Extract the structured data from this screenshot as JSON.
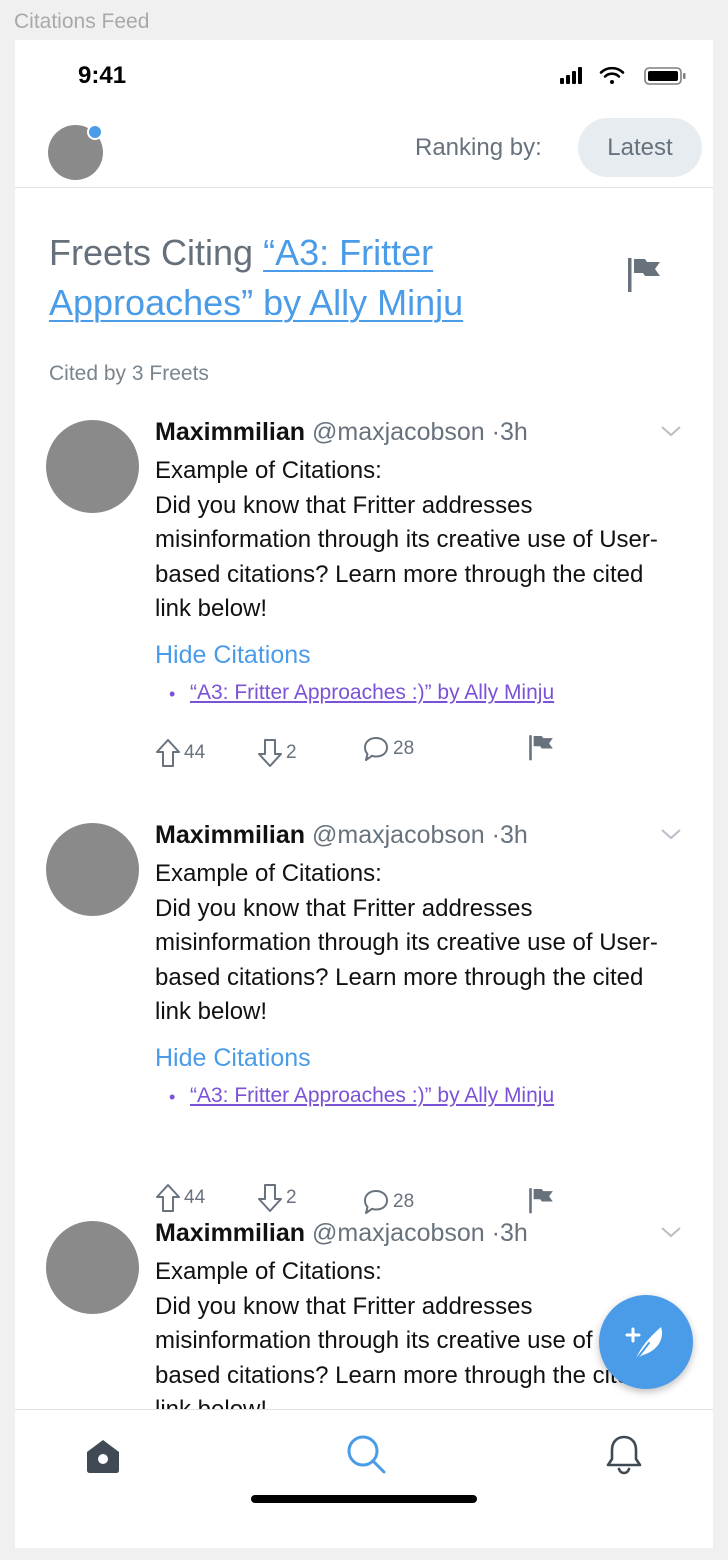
{
  "window": {
    "title": "Citations Feed"
  },
  "status_bar": {
    "time": "9:41",
    "icons": [
      "cellular-signal-icon",
      "wifi-icon",
      "battery-icon"
    ]
  },
  "header": {
    "ranking_label": "Ranking by:",
    "ranking_value": "Latest"
  },
  "page": {
    "title_prefix": "Freets Citing ",
    "title_link": "“A3: Fritter Approaches” by Ally Minju",
    "cited_count": "Cited by 3 Freets"
  },
  "freets": [
    {
      "author": "Maximmilian",
      "handle": "@maxjacobson",
      "time": "·3h",
      "body_line1": "Example of Citations:",
      "body_line2": "Did you know that Fritter addresses misinformation through its creative use of User-based citations? Learn more through the cited link below!",
      "hide_citations": "Hide Citations",
      "citation": "“A3: Fritter Approaches :)” by Ally Minju",
      "upvotes": "44",
      "downvotes": "2",
      "comments": "28"
    },
    {
      "author": "Maximmilian",
      "handle": "@maxjacobson",
      "time": "·3h",
      "body_line1": "Example of Citations:",
      "body_line2": "Did you know that Fritter addresses misinformation through its creative use of User-based citations? Learn more through the cited link below!",
      "hide_citations": "Hide Citations",
      "citation": "“A3: Fritter Approaches :)” by Ally Minju",
      "upvotes": "44",
      "downvotes": "2",
      "comments": "28"
    },
    {
      "author": "Maximmilian",
      "handle": "@maxjacobson",
      "time": "·3h",
      "body_line1": "Example of Citations:",
      "body_line2": "Did you know that Fritter addresses misinformation through its creative use of User-based citations? Learn more through the cited link below!"
    }
  ],
  "tabs": [
    {
      "name": "home",
      "icon": "home-icon"
    },
    {
      "name": "search",
      "icon": "search-icon"
    },
    {
      "name": "notifications",
      "icon": "bell-icon"
    }
  ],
  "fab": {
    "icon": "compose-feather-icon"
  },
  "colors": {
    "accent": "#4a9be8",
    "link_visited": "#7b52d6",
    "muted": "#68727d"
  }
}
